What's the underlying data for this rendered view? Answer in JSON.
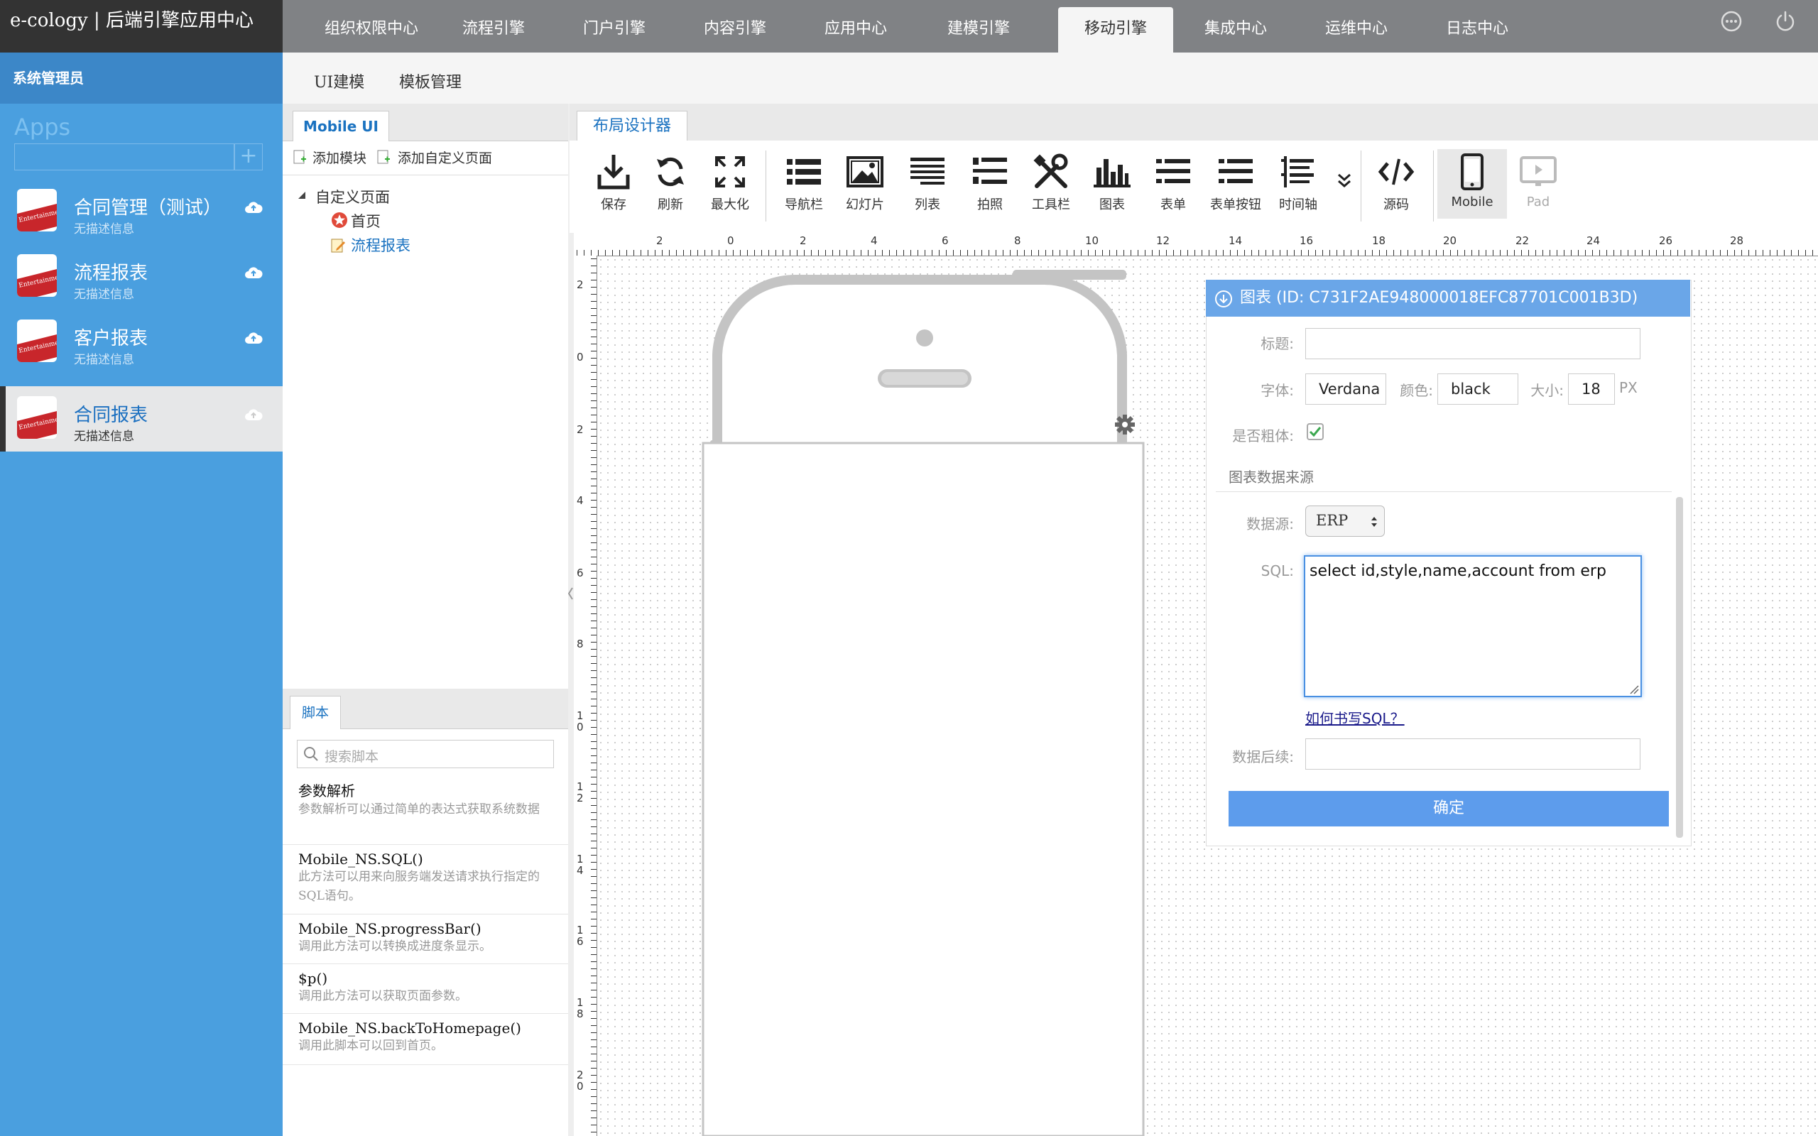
{
  "brand": "e-cology | 后端引擎应用中心",
  "topnav": {
    "tabs": [
      "组织权限中心",
      "流程引擎",
      "门户引擎",
      "内容引擎",
      "应用中心",
      "建模引擎",
      "移动引擎",
      "集成中心",
      "运维中心",
      "日志中心"
    ],
    "active": "移动引擎"
  },
  "subnav": {
    "tabs": [
      "UI建模",
      "模板管理"
    ]
  },
  "sidebar": {
    "user": "系统管理员",
    "apps_title": "Apps",
    "add_symbol": "+",
    "icon_text": "Entertainme",
    "items": [
      {
        "name": "合同管理（测试）",
        "desc": "无描述信息"
      },
      {
        "name": "流程报表",
        "desc": "无描述信息"
      },
      {
        "name": "客户报表",
        "desc": "无描述信息"
      },
      {
        "name": "合同报表",
        "desc": "无描述信息"
      }
    ]
  },
  "mobile_ui": {
    "tab": "Mobile UI",
    "add_module": "添加模块",
    "add_custom_page": "添加自定义页面",
    "tree_root": "自定义页面",
    "tree_children": [
      "首页",
      "流程报表"
    ]
  },
  "script": {
    "tab": "脚本",
    "search_placeholder": "搜索脚本",
    "items": [
      {
        "title": "参数解析",
        "desc": "参数解析可以通过简单的表达式获取系统数据"
      },
      {
        "title": "Mobile_NS.SQL()",
        "desc": "此方法可以用来向服务端发送请求执行指定的SQL语句。"
      },
      {
        "title": "Mobile_NS.progressBar()",
        "desc": "调用此方法可以转换成进度条显示。"
      },
      {
        "title": "$p()",
        "desc": "调用此方法可以获取页面参数。"
      },
      {
        "title": "Mobile_NS.backToHomepage()",
        "desc": "调用此脚本可以回到首页。"
      }
    ]
  },
  "designer": {
    "tab": "布局设计器",
    "tools": [
      "保存",
      "刷新",
      "最大化",
      "导航栏",
      "幻灯片",
      "列表",
      "拍照",
      "工具栏",
      "图表",
      "表单",
      "表单按钮",
      "时间轴"
    ],
    "source": "源码",
    "device_mobile": "Mobile",
    "device_pad": "Pad",
    "ruler_h": [
      "2",
      "0",
      "2",
      "4",
      "6",
      "8",
      "10",
      "12",
      "14",
      "16",
      "18",
      "20",
      "22",
      "24",
      "26",
      "28"
    ],
    "ruler_v": [
      "2",
      "0",
      "2",
      "4",
      "6",
      "8",
      "1 0",
      "1 2",
      "1 4",
      "1 6",
      "1 8",
      "2 0"
    ]
  },
  "chart_props": {
    "header": "图表 (ID:  C731F2AE948000018EFC87701C001B3D)",
    "title_label": "标题:",
    "title_value": "",
    "font_label": "字体:",
    "font_value": "Verdana",
    "color_label": "颜色:",
    "color_value": "black",
    "size_label": "大小:",
    "size_value": "18",
    "size_unit": "PX",
    "bold_label": "是否粗体:",
    "bold_checked": true,
    "section": "图表数据来源",
    "datasource_label": "数据源:",
    "datasource_value": "ERP",
    "sql_label": "SQL:",
    "sql_value": "select id,style,name,account from erp",
    "sql_help": "如何书写SQL？",
    "postproc_label": "数据后续:",
    "postproc_value": "",
    "confirm": "确定"
  }
}
